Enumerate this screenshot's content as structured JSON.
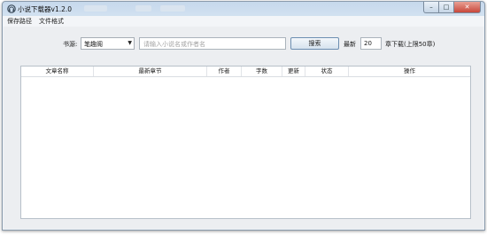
{
  "window": {
    "title": "小说下载器v1.2.0",
    "close_glyph": "✕",
    "min_glyph": "–",
    "max_glyph": "□"
  },
  "menu": {
    "items": [
      "保存路径",
      "文件格式"
    ]
  },
  "toolbar": {
    "source_label": "书源:",
    "source_value": "笔趣阁",
    "search_placeholder": "请输入小说名或作者名",
    "search_button": "搜索",
    "latest_label": "最新",
    "latest_count": "20",
    "chapters_suffix": "章下载(上限50章)"
  },
  "table": {
    "columns": [
      "文章名称",
      "最新章节",
      "作者",
      "字数",
      "更新",
      "状态",
      "操作"
    ],
    "rows": []
  },
  "colors": {
    "titlebar": "#c6d8ec",
    "close_button": "#c8473a",
    "window_body": "#eceef1"
  }
}
